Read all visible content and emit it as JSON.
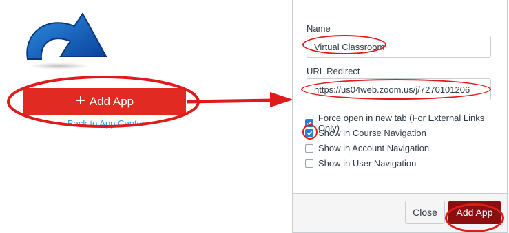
{
  "left_panel": {
    "add_app_label": "Add App",
    "back_link": "Back to App Center"
  },
  "modal": {
    "name_label": "Name",
    "name_value": "Virtual Classroom",
    "url_label": "URL Redirect",
    "url_value": "https://us04web.zoom.us/j/7270101206",
    "options": [
      {
        "label": "Force open in new tab (For External Links Only)",
        "checked": true
      },
      {
        "label": "Show in Course Navigation",
        "checked": true
      },
      {
        "label": "Show in Account Navigation",
        "checked": false
      },
      {
        "label": "Show in User Navigation",
        "checked": false
      }
    ],
    "close_label": "Close",
    "submit_label": "Add App"
  },
  "colors": {
    "primary_red": "#e02a22",
    "submit_dark_red": "#8a1010",
    "annotation_red": "#e0191b",
    "checkbox_blue": "#2b7fd1",
    "link_blue": "#2b9be2"
  },
  "icons": [
    "redirect-arrow-icon",
    "plus-icon",
    "check-icon"
  ]
}
